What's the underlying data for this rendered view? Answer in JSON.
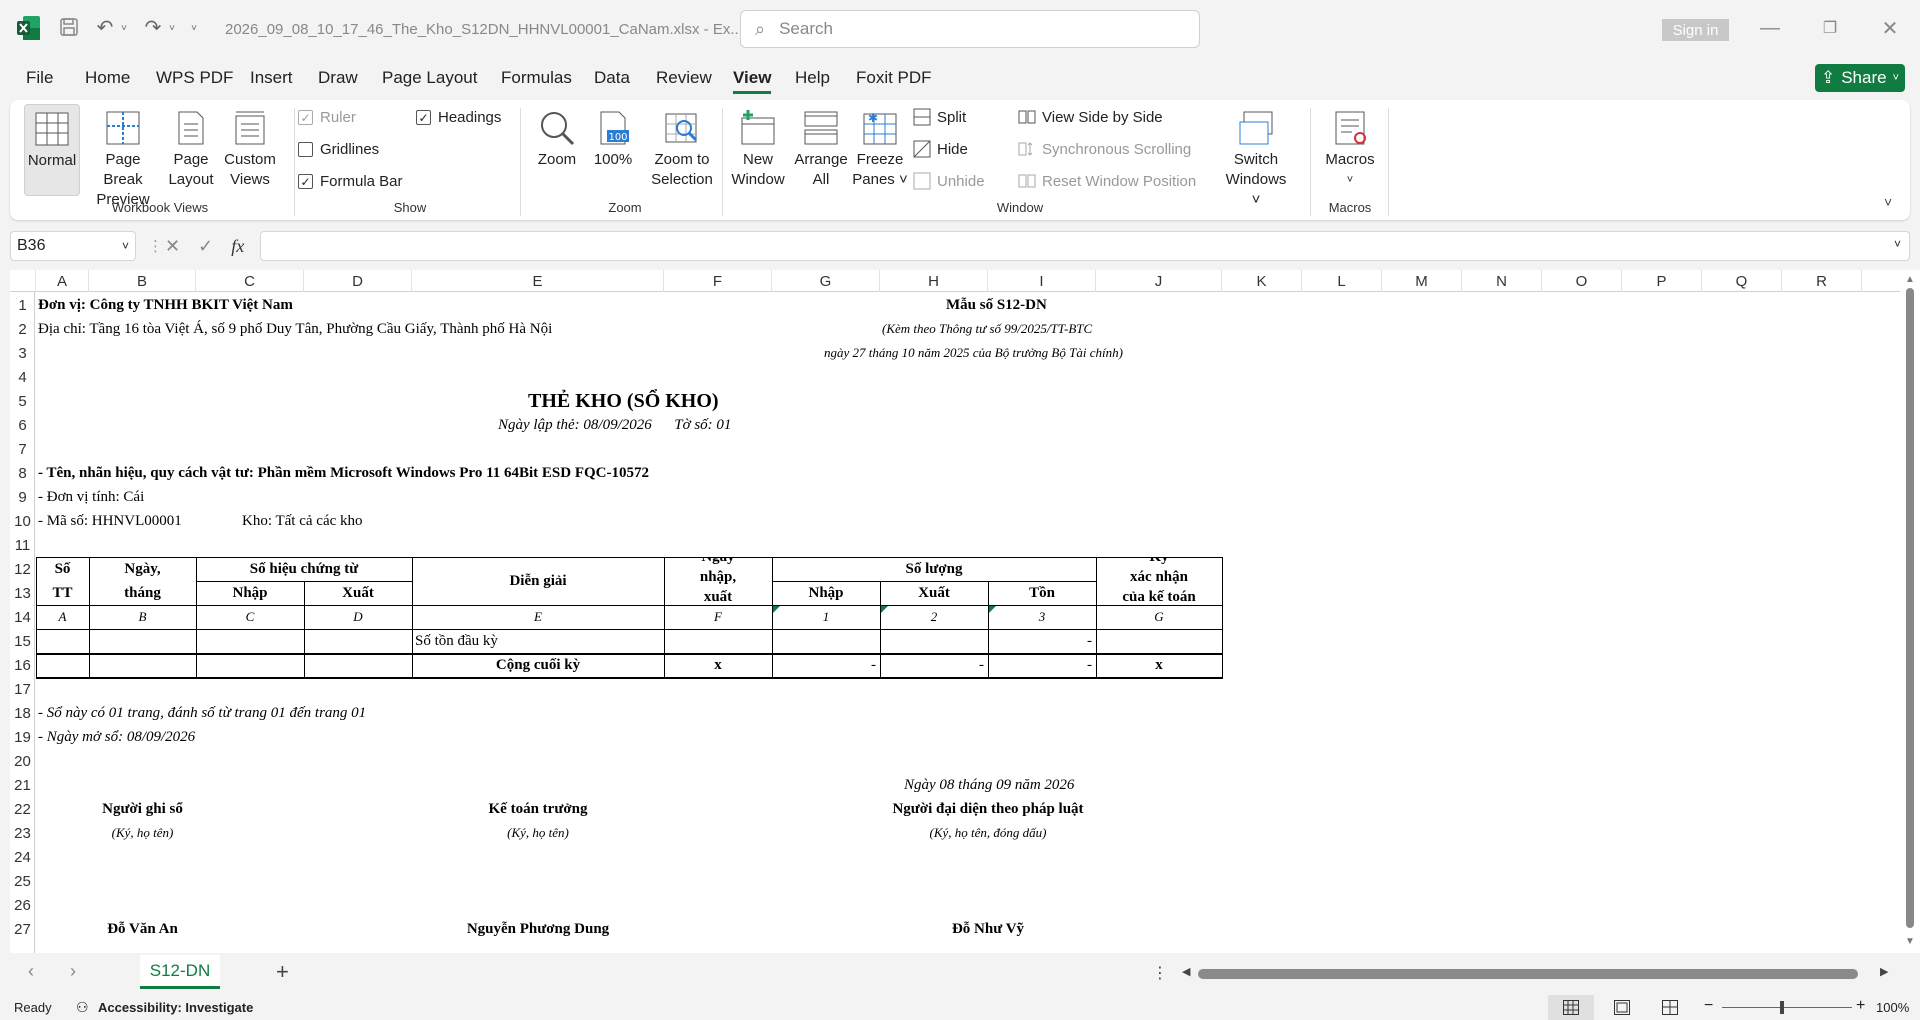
{
  "titlebar": {
    "filename": "2026_09_08_10_17_46_The_Kho_S12DN_HHNVL00001_CaNam.xlsx - Ex...",
    "search_placeholder": "Search",
    "signin": "Sign in"
  },
  "menu": [
    "File",
    "Home",
    "WPS PDF",
    "Insert",
    "Draw",
    "Page Layout",
    "Formulas",
    "Data",
    "Review",
    "View",
    "Help",
    "Foxit PDF"
  ],
  "active_menu": "View",
  "share_label": "Share",
  "ribbon": {
    "normal": "Normal",
    "page_break_1": "Page Break",
    "page_break_2": "Preview",
    "page_layout_1": "Page",
    "page_layout_2": "Layout",
    "custom_views_1": "Custom",
    "custom_views_2": "Views",
    "group_workbook_views": "Workbook Views",
    "ruler": "Ruler",
    "headings": "Headings",
    "gridlines": "Gridlines",
    "formula_bar": "Formula Bar",
    "group_show": "Show",
    "zoom": "Zoom",
    "zoom100": "100%",
    "zoom_sel_1": "Zoom to",
    "zoom_sel_2": "Selection",
    "group_zoom": "Zoom",
    "new_window_1": "New",
    "new_window_2": "Window",
    "arrange_1": "Arrange",
    "arrange_2": "All",
    "freeze_1": "Freeze",
    "freeze_2": "Panes ˅",
    "split": "Split",
    "hide": "Hide",
    "unhide": "Unhide",
    "side_by_side": "View Side by Side",
    "sync_scroll": "Synchronous Scrolling",
    "reset_pos": "Reset Window Position",
    "switch_1": "Switch",
    "switch_2": "Windows ˅",
    "group_window": "Window",
    "macros": "Macros",
    "group_macros": "Macros"
  },
  "namebox": "B36",
  "columns": [
    "A",
    "B",
    "C",
    "D",
    "E",
    "F",
    "G",
    "H",
    "I",
    "J",
    "K",
    "L",
    "M",
    "N",
    "O",
    "P",
    "Q",
    "R"
  ],
  "rows": [
    "1",
    "2",
    "3",
    "4",
    "5",
    "6",
    "7",
    "8",
    "9",
    "10",
    "11",
    "12",
    "13",
    "14",
    "15",
    "16",
    "17",
    "18",
    "19",
    "20",
    "21",
    "22",
    "23",
    "24",
    "25",
    "26",
    "27"
  ],
  "sheet": {
    "r1_left": "Đơn vị: Công ty TNHH BKIT Việt Nam",
    "r1_right": "Mẫu số S12-DN",
    "r2_left": "Địa chỉ: Tầng 16 tòa Việt Á, số 9 phố Duy Tân, Phường Cầu Giấy, Thành phố Hà Nội",
    "r2_right": "(Kèm theo Thông tư số 99/2025/TT-BTC",
    "r3_right": "ngày 27 tháng 10 năm 2025 của Bộ trưởng Bộ Tài chính)",
    "title": "THẺ KHO (SỔ KHO)",
    "date_line": "Ngày lập thẻ: 08/09/2026      Tờ số: 01",
    "r8": "- Tên, nhãn hiệu, quy cách vật tư: Phần mềm Microsoft Windows Pro 11 64Bit ESD FQC-10572",
    "r9": "- Đơn vị tính: Cái",
    "r10a": "- Mã số: HHNVL00001",
    "r10b": "Kho: Tất cả các kho",
    "h_stt_1": "Số",
    "h_stt_2": "TT",
    "h_date_1": "Ngày,",
    "h_date_2": "tháng",
    "h_sohieu": "Số hiệu chứng từ",
    "h_nhap": "Nhập",
    "h_xuat": "Xuất",
    "h_diengiai": "Diễn giải",
    "h_ngay_1": "Ngày",
    "h_ngay_2": "nhập,",
    "h_ngay_3": "xuất",
    "h_soluong": "Số lượng",
    "h_q_nhap": "Nhập",
    "h_q_xuat": "Xuất",
    "h_q_ton": "Tồn",
    "h_ky_1": "Ký",
    "h_ky_2": "xác nhận",
    "h_ky_3": "của kế toán",
    "code_row": [
      "A",
      "B",
      "C",
      "D",
      "E",
      "F",
      "1",
      "2",
      "3",
      "G"
    ],
    "r15_desc": "Số tồn đầu kỳ",
    "r15_ton": "-",
    "r16_desc": "Cộng cuối kỳ",
    "r16_f": "x",
    "r16_g": "-",
    "r16_h": "-",
    "r16_i": "-",
    "r16_j": "x",
    "r18": "- Sổ này có 01 trang, đánh số từ trang 01 đến trang 01",
    "r19": "- Ngày mở sổ: 08/09/2026",
    "r21": "Ngày 08 tháng 09 năm 2026",
    "sig1": "Người ghi sổ",
    "sig2": "Kế toán trưởng",
    "sig3": "Người đại diện theo pháp luật",
    "sig1_note": "(Ký, họ tên)",
    "sig2_note": "(Ký, họ tên)",
    "sig3_note": "(Ký, họ tên, đóng dấu)",
    "name1": "Đỗ Văn An",
    "name2": "Nguyễn Phương Dung",
    "name3": "Đỗ Như Vỹ"
  },
  "tab": "S12-DN",
  "status": {
    "ready": "Ready",
    "accessibility": "Accessibility: Investigate",
    "zoom": "100%"
  }
}
